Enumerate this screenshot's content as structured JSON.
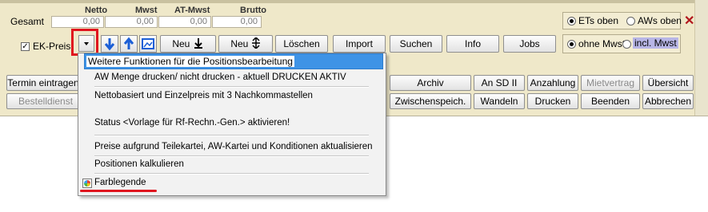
{
  "totals": {
    "row_label": "Gesamt",
    "headers": [
      "Netto",
      "Mwst",
      "AT-Mwst",
      "Brutto"
    ],
    "values": [
      "0,00",
      "0,00",
      "0,00",
      "0,00"
    ]
  },
  "display_options": {
    "ets_oben": "ETs oben",
    "aws_oben": "AWs oben",
    "ohne_mwst": "ohne Mwst.",
    "incl_mwst": "incl. Mwst"
  },
  "toolbar": {
    "ek_preis": "EK-Preis",
    "neu1": "Neu",
    "neu2": "Neu",
    "loeschen": "Löschen",
    "import": "Import",
    "suchen": "Suchen",
    "info": "Info",
    "jobs": "Jobs"
  },
  "action_buttons": {
    "termin": "Termin eintragen",
    "bestelldienst": "Bestelldienst",
    "archiv": "Archiv",
    "an_sd": "An SD II",
    "anzahlung": "Anzahlung",
    "mietvertrag": "Mietvertrag",
    "uebersicht": "Übersicht",
    "zwischenspeich": "Zwischenspeich.",
    "wandeln": "Wandeln",
    "drucken": "Drucken",
    "beenden": "Beenden",
    "abbrechen": "Abbrechen"
  },
  "menu": {
    "tooltip": "Weitere Funktionen für die Positionsbearbeitung",
    "items": [
      "AW Menge drucken/ nicht drucken - aktuell DRUCKEN AKTIV",
      "Nettobasiert und Einzelpreis mit 3 Nachkommastellen",
      "Status <Vorlage für Rf-Rechn.-Gen.> aktivieren!",
      "Preise aufgrund Teilekartei, AW-Kartei und Konditionen aktualisieren",
      "Positionen kalkulieren",
      "Farblegende"
    ]
  },
  "colors": {
    "panel": "#efe8c9",
    "highlight": "#3e93e6",
    "annotation_red": "#e0141e",
    "arrow_blue": "#1c5fd6"
  },
  "icons": [
    "dropdown-arrow-icon",
    "arrow-down-icon",
    "arrow-up-icon",
    "image-icon",
    "down-arrow-bar-icon",
    "split-arrow-icon",
    "close-icon",
    "color-legend-icon"
  ]
}
